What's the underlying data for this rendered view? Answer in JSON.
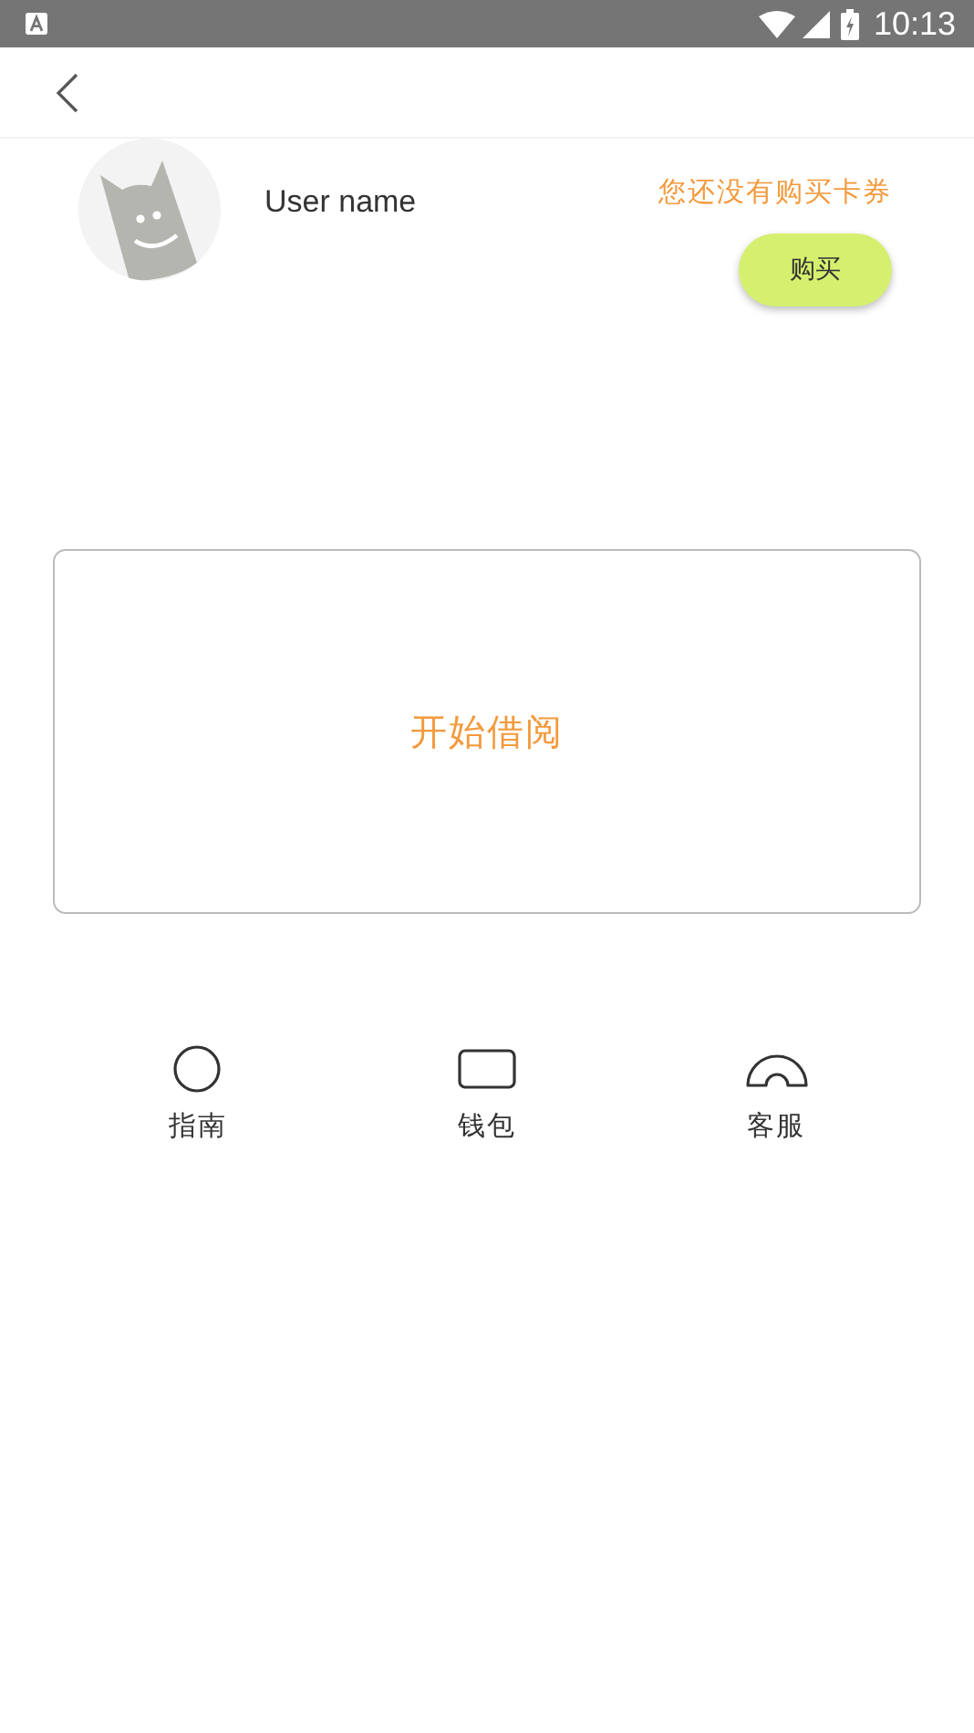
{
  "status_bar": {
    "time": "10:13"
  },
  "profile": {
    "user_name": "User name",
    "notice": "您还没有购买卡券",
    "buy_button": "购买"
  },
  "borrow_card": {
    "label": "开始借阅"
  },
  "menu": [
    {
      "label": "指南"
    },
    {
      "label": "钱包"
    },
    {
      "label": "客服"
    }
  ]
}
